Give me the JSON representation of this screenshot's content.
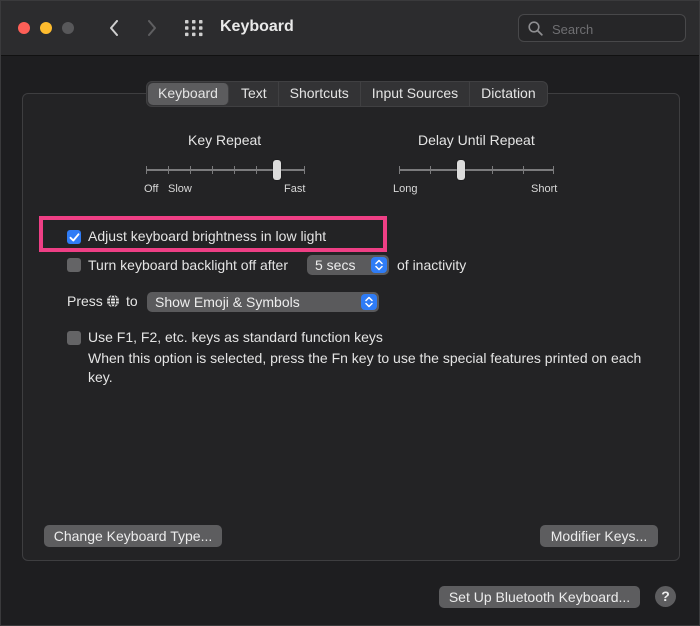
{
  "window": {
    "title": "Keyboard",
    "search_placeholder": "Search"
  },
  "tabs": [
    {
      "label": "Keyboard",
      "active": true
    },
    {
      "label": "Text",
      "active": false
    },
    {
      "label": "Shortcuts",
      "active": false
    },
    {
      "label": "Input Sources",
      "active": false
    },
    {
      "label": "Dictation",
      "active": false
    }
  ],
  "key_repeat": {
    "label": "Key Repeat",
    "left_labels": [
      "Off",
      "Slow"
    ],
    "right_label": "Fast",
    "value_fraction": 0.9
  },
  "delay_until_repeat": {
    "label": "Delay Until Repeat",
    "left_label": "Long",
    "right_label": "Short",
    "value_fraction": 0.4
  },
  "options": {
    "adjust_brightness": {
      "label": "Adjust keyboard brightness in low light",
      "checked": true
    },
    "backlight_off": {
      "label": "Turn keyboard backlight off after",
      "checked": false,
      "value": "5 secs",
      "suffix": "of inactivity"
    },
    "press_globe": {
      "prefix": "Press",
      "suffix": "to",
      "value": "Show Emoji & Symbols"
    },
    "function_keys": {
      "label": "Use F1, F2, etc. keys as standard function keys",
      "checked": false,
      "description": "When this option is selected, press the Fn key to use the special features printed on each key."
    }
  },
  "buttons": {
    "change_type": "Change Keyboard Type...",
    "modifier_keys": "Modifier Keys...",
    "bluetooth": "Set Up Bluetooth Keyboard...",
    "help": "?"
  },
  "colors": {
    "accent": "#2f7cf6",
    "highlight": "#ee3f85"
  }
}
